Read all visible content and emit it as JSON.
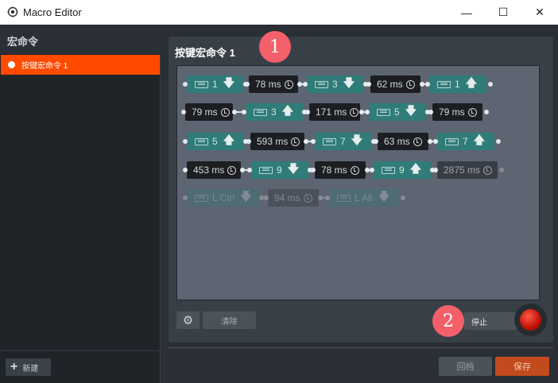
{
  "window": {
    "title": "Macro Editor",
    "minimize": "—",
    "maximize": "☐",
    "close": "✕"
  },
  "sidebar": {
    "title": "宏命令",
    "items": [
      {
        "label": "按键宏命令 1",
        "selected": true
      }
    ],
    "new_label": "新建"
  },
  "main": {
    "title": "按键宏命令 1",
    "clear_label": "清除",
    "stop_label": "停止"
  },
  "footer": {
    "recall_label": "回档",
    "save_label": "保存"
  },
  "badges": {
    "one": "1",
    "two": "2"
  },
  "steps": [
    {
      "kind": "key",
      "key": "1",
      "dir": "down"
    },
    {
      "kind": "delay",
      "ms": "78 ms"
    },
    {
      "kind": "key",
      "key": "3",
      "dir": "down"
    },
    {
      "kind": "delay",
      "ms": "62 ms"
    },
    {
      "kind": "key",
      "key": "1",
      "dir": "up"
    },
    {
      "kind": "delay",
      "ms": "79 ms"
    },
    {
      "kind": "key",
      "key": "3",
      "dir": "up"
    },
    {
      "kind": "delay",
      "ms": "171 ms"
    },
    {
      "kind": "key",
      "key": "5",
      "dir": "down"
    },
    {
      "kind": "delay",
      "ms": "79 ms"
    },
    {
      "kind": "key",
      "key": "5",
      "dir": "up"
    },
    {
      "kind": "delay",
      "ms": "593 ms"
    },
    {
      "kind": "key",
      "key": "7",
      "dir": "down"
    },
    {
      "kind": "delay",
      "ms": "63 ms"
    },
    {
      "kind": "key",
      "key": "7",
      "dir": "up"
    },
    {
      "kind": "delay",
      "ms": "453 ms"
    },
    {
      "kind": "key",
      "key": "9",
      "dir": "down"
    },
    {
      "kind": "delay",
      "ms": "78 ms"
    },
    {
      "kind": "key",
      "key": "9",
      "dir": "up"
    },
    {
      "kind": "delay",
      "ms": "2875 ms"
    },
    {
      "kind": "key",
      "key": "L Ctrl",
      "dir": "down"
    },
    {
      "kind": "delay",
      "ms": "94 ms"
    },
    {
      "kind": "key",
      "key": "L Alt",
      "dir": "down"
    }
  ],
  "icons": {
    "down": "🡇",
    "up": "🡅"
  },
  "colors": {
    "accent": "#ff4a00",
    "key_chip": "#2f7c79",
    "delay_chip": "#1c1e22",
    "record": "#c00f05"
  }
}
